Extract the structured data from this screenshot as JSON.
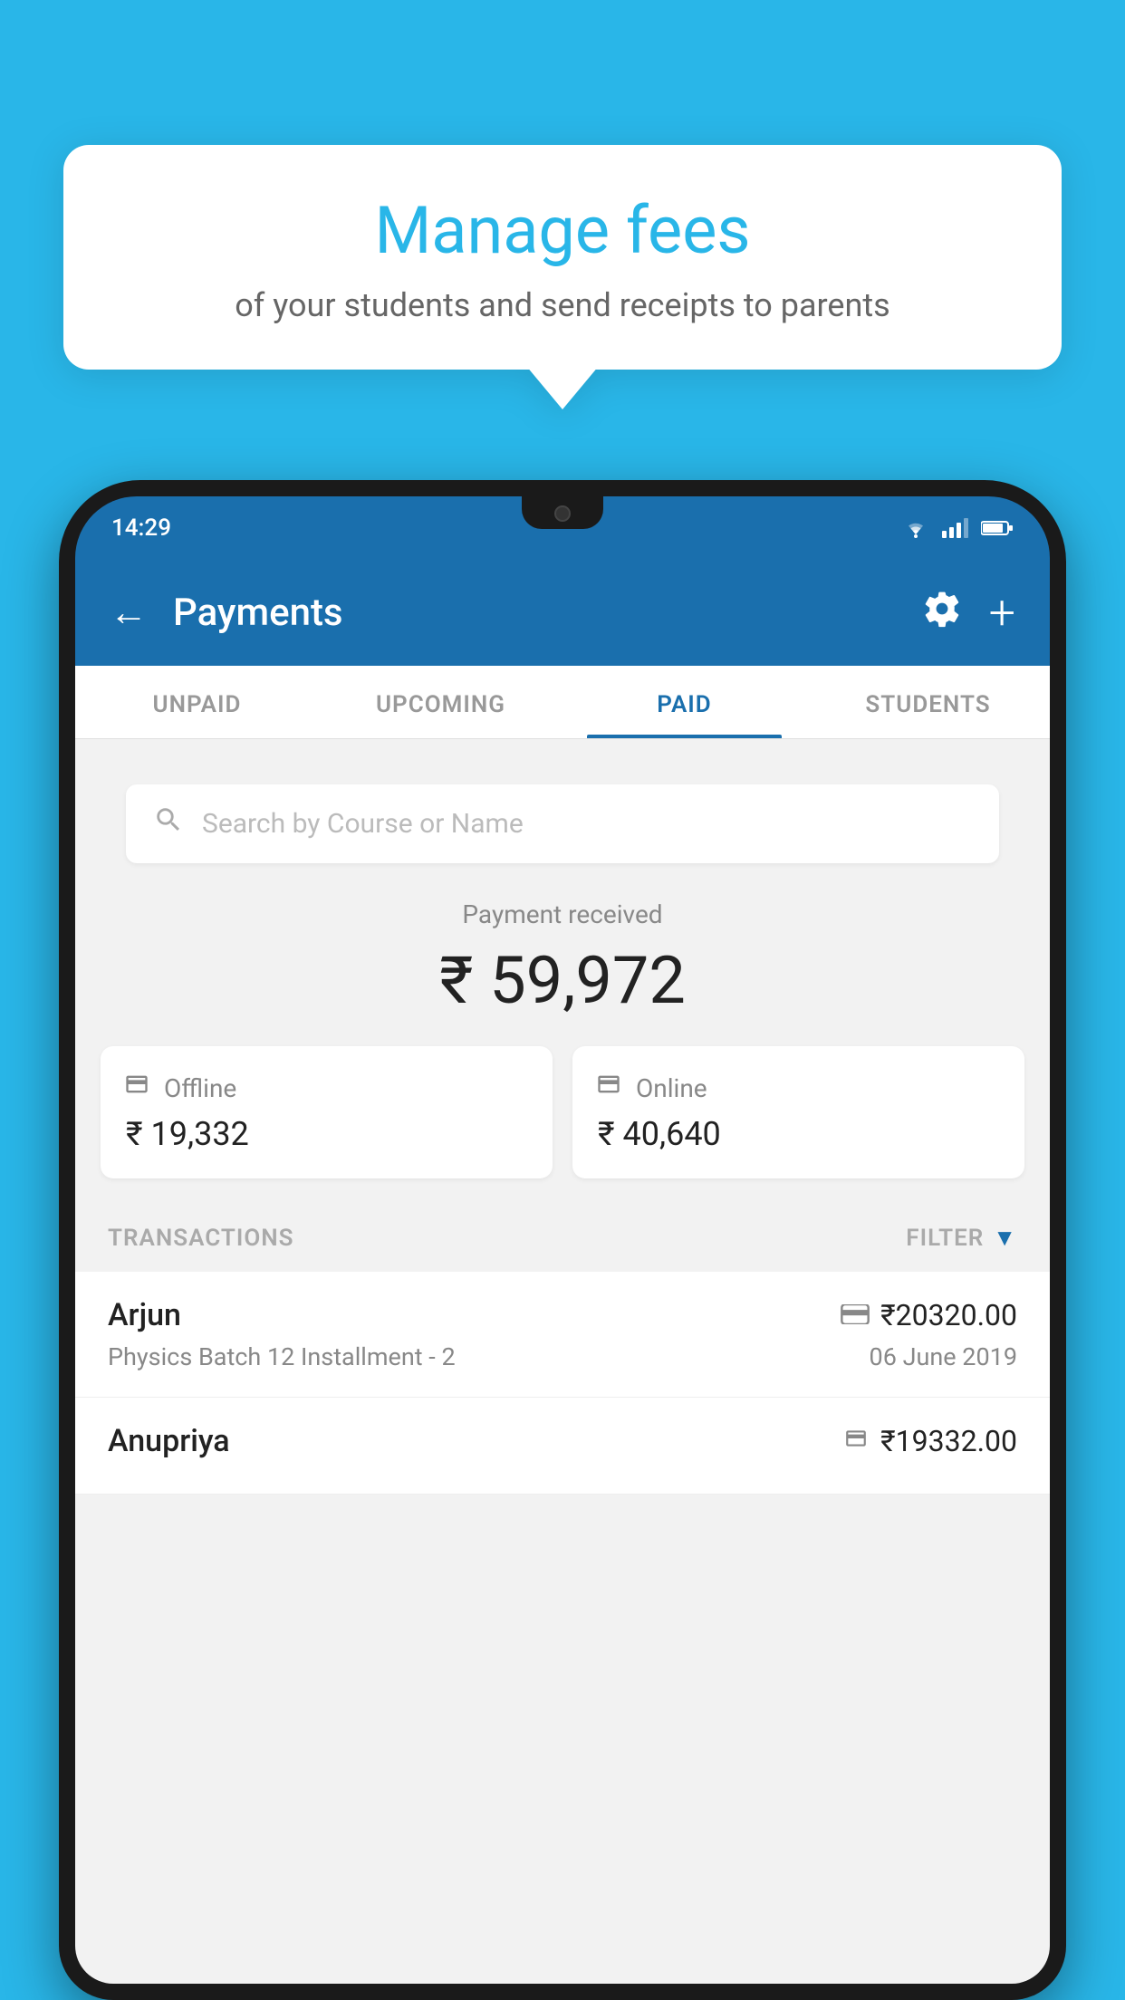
{
  "tooltip": {
    "title": "Manage fees",
    "subtitle": "of your students and send receipts to parents"
  },
  "status_bar": {
    "time": "14:29"
  },
  "header": {
    "title": "Payments",
    "back_label": "←",
    "settings_label": "⚙",
    "add_label": "+"
  },
  "tabs": [
    {
      "id": "unpaid",
      "label": "UNPAID",
      "active": false
    },
    {
      "id": "upcoming",
      "label": "UPCOMING",
      "active": false
    },
    {
      "id": "paid",
      "label": "PAID",
      "active": true
    },
    {
      "id": "students",
      "label": "STUDENTS",
      "active": false
    }
  ],
  "search": {
    "placeholder": "Search by Course or Name"
  },
  "payment_summary": {
    "label": "Payment received",
    "amount": "₹ 59,972",
    "offline_label": "Offline",
    "offline_amount": "₹ 19,332",
    "online_label": "Online",
    "online_amount": "₹ 40,640"
  },
  "transactions": {
    "header_label": "TRANSACTIONS",
    "filter_label": "FILTER",
    "items": [
      {
        "name": "Arjun",
        "course": "Physics Batch 12 Installment - 2",
        "amount": "₹20320.00",
        "date": "06 June 2019",
        "method": "card"
      },
      {
        "name": "Anupriya",
        "course": "",
        "amount": "₹19332.00",
        "date": "",
        "method": "cash"
      }
    ]
  },
  "colors": {
    "primary_blue": "#1a6fad",
    "light_blue_bg": "#29b6e8",
    "white": "#ffffff",
    "text_dark": "#222222",
    "text_gray": "#888888",
    "text_light": "#aaaaaa"
  }
}
